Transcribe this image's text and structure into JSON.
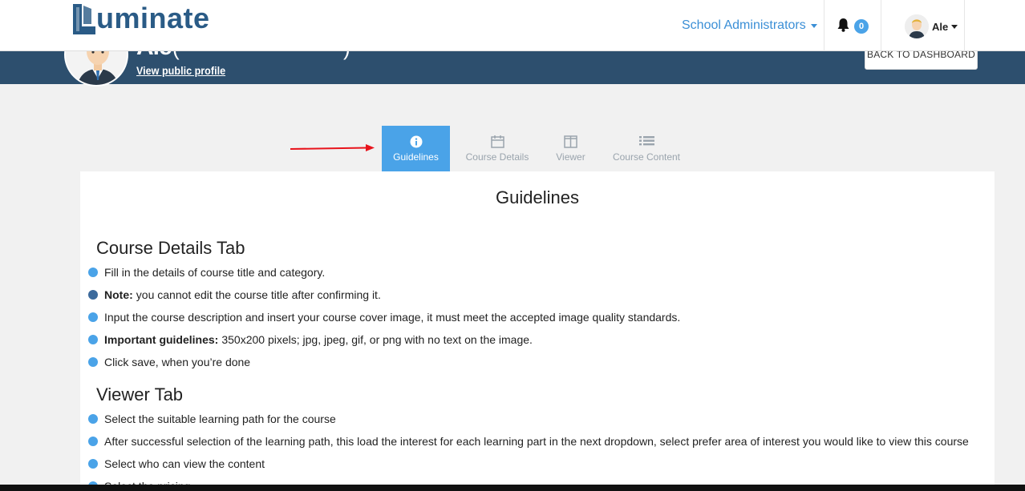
{
  "header": {
    "brand": "uminate",
    "role_menu": "School Administrators",
    "notifications_count": "0",
    "user_name": "Ale"
  },
  "profile": {
    "name": "Ale",
    "view_profile": "View public profile",
    "back_button": "BACK TO DASHBOARD"
  },
  "tabs": [
    {
      "label": "Guidelines",
      "icon": "info-circle-icon",
      "active": true
    },
    {
      "label": "Course Details",
      "icon": "calendar-icon",
      "active": false
    },
    {
      "label": "Viewer",
      "icon": "columns-icon",
      "active": false
    },
    {
      "label": "Course Content",
      "icon": "list-icon",
      "active": false
    }
  ],
  "guidelines": {
    "title": "Guidelines",
    "course_details": {
      "heading": "Course Details Tab",
      "items": [
        {
          "bold": "",
          "text": "Fill in the details of course title and category."
        },
        {
          "bold": "Note:",
          "text": "you cannot edit the course title after confirming it."
        },
        {
          "bold": "",
          "text": "Input the course description and insert your course cover image, it must meet the accepted image quality standards."
        },
        {
          "bold": "Important guidelines:",
          "text": "350x200 pixels; jpg, jpeg, gif, or png with no text on the image."
        },
        {
          "bold": "",
          "text": "Click save, when you’re done"
        }
      ]
    },
    "viewer": {
      "heading": "Viewer Tab",
      "items": [
        {
          "bold": "",
          "text": "Select the suitable learning path for the course"
        },
        {
          "bold": "",
          "text": "After successful selection of the learning path, this load the interest for each learning part in the next dropdown, select prefer area of interest you would like to view this course"
        },
        {
          "bold": "",
          "text": "Select who can view the content"
        },
        {
          "bold": "",
          "text": "Select the pricing"
        }
      ]
    }
  },
  "colors": {
    "accent": "#4aa3e8",
    "banner": "#2d4f6e",
    "brand": "#2a5b86",
    "annotation_arrow": "#e8141c"
  }
}
